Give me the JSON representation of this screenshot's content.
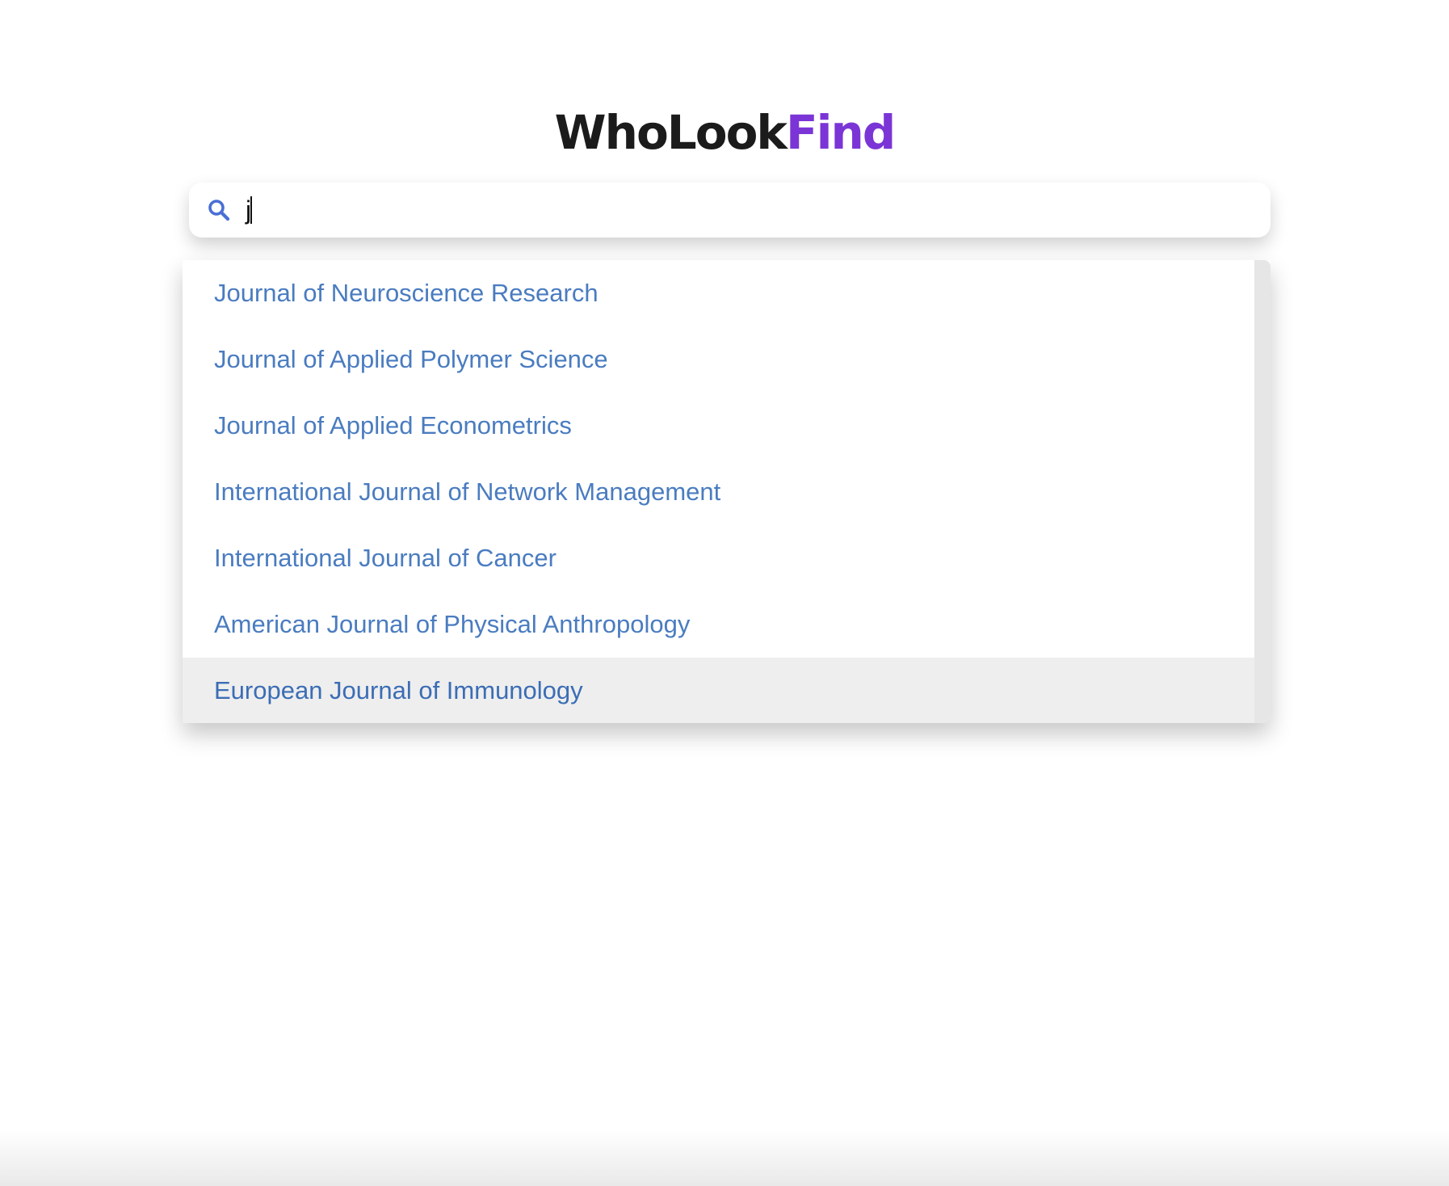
{
  "logo": {
    "part_a": "WhoLook",
    "part_b": "Find",
    "accent_color": "#7b35d6"
  },
  "search": {
    "value": "j",
    "icon": "search-icon",
    "icon_color": "#4a6ed6"
  },
  "suggestions": {
    "link_color": "#4a7cc0",
    "highlight_background": "#eeeeee",
    "items": [
      {
        "label": "Journal of Neuroscience Research"
      },
      {
        "label": "Journal of Applied Polymer Science"
      },
      {
        "label": "Journal of Applied Econometrics"
      },
      {
        "label": "International Journal of Network Management"
      },
      {
        "label": "International Journal of Cancer"
      },
      {
        "label": "American Journal of Physical Anthropology"
      },
      {
        "label": "European Journal of Immunology"
      }
    ],
    "highlighted_index": 6
  }
}
